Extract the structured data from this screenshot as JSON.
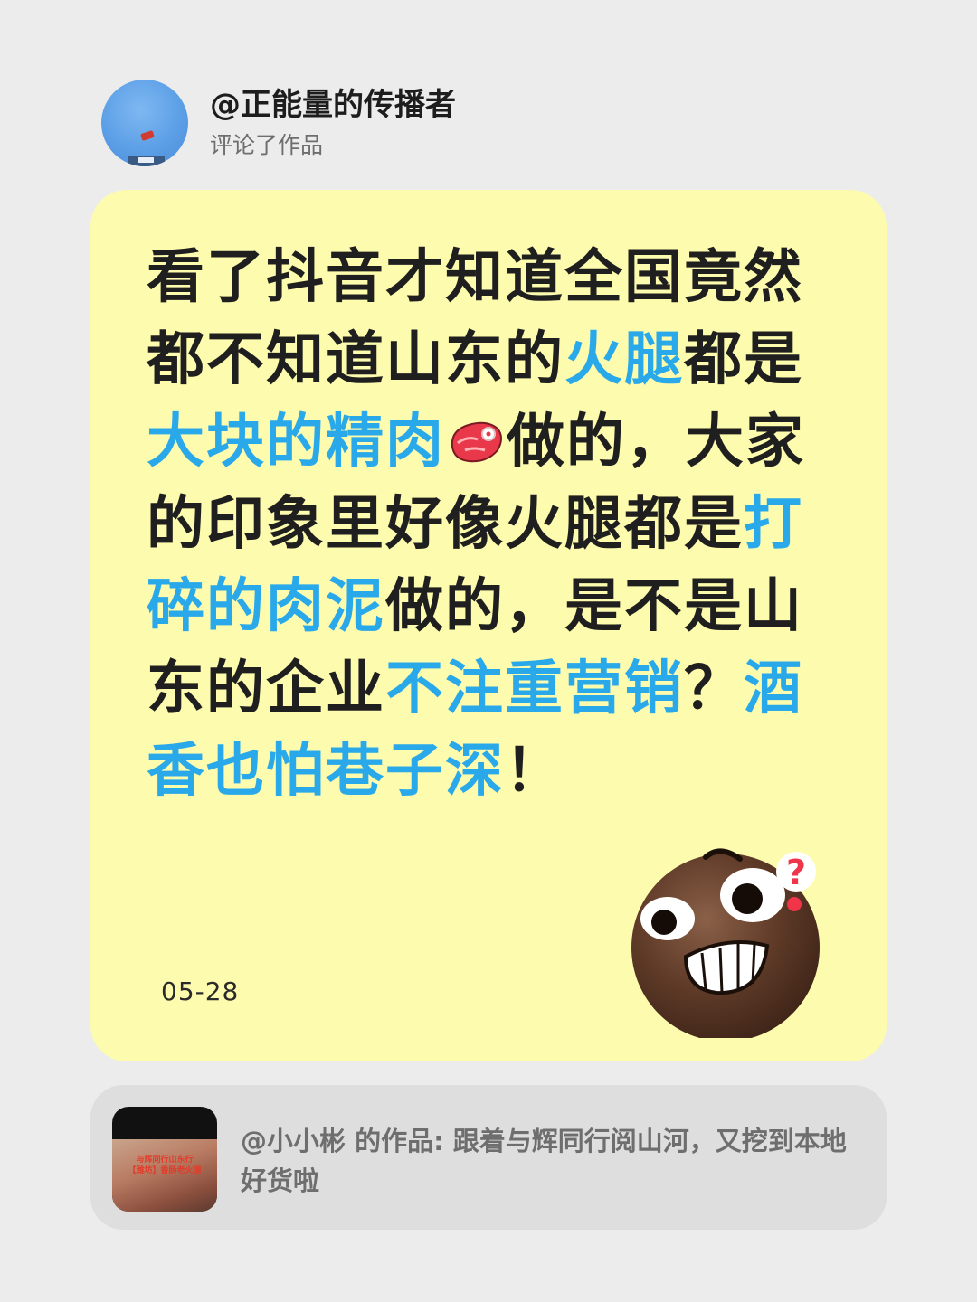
{
  "header": {
    "username": "@正能量的传播者",
    "action": "评论了作品"
  },
  "comment": {
    "segments": [
      {
        "text": "看了抖音才知道全国竟然都不知道山东的",
        "highlight": false
      },
      {
        "text": "火腿",
        "highlight": true
      },
      {
        "text": "都是",
        "highlight": false
      },
      {
        "text": "大块的精肉",
        "highlight": true
      },
      {
        "icon": "meat-emoji-icon"
      },
      {
        "text": "做的，大家的印象里好像火腿都是",
        "highlight": false
      },
      {
        "text": "打碎的肉泥",
        "highlight": true
      },
      {
        "text": "做的，是不是山东的企业",
        "highlight": false
      },
      {
        "text": "不注重营销",
        "highlight": true
      },
      {
        "text": "？",
        "highlight": false
      },
      {
        "text": "酒香也怕巷子深",
        "highlight": true
      },
      {
        "text": "！",
        "highlight": false
      }
    ],
    "date": "05-28",
    "sticker": "confused-grin-face-sticker"
  },
  "work": {
    "text": "@小小彬 的作品: 跟着与辉同行阅山河，又挖到本地好货啦",
    "thumb_caption_line1": "与辉同行山东行",
    "thumb_caption_line2": "【潍坊】香肠老火腿"
  },
  "colors": {
    "background": "#ececec",
    "comment_card": "#fdfbae",
    "highlight": "#2aa9ea",
    "text": "#1f1f1f",
    "work_card": "#dedede"
  }
}
